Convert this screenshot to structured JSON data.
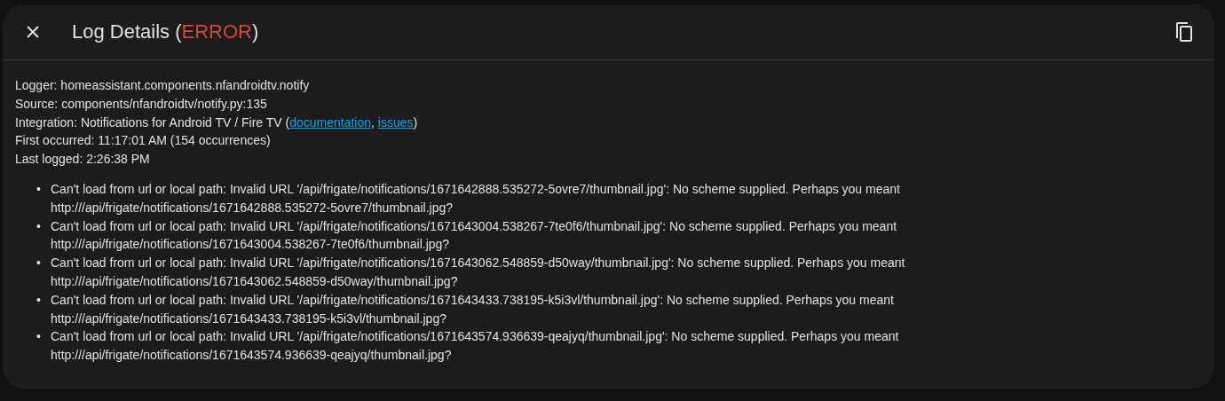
{
  "dialog": {
    "title": {
      "before": "Log Details (",
      "level": "ERROR",
      "after": ")"
    },
    "details": [
      {
        "kind": "text",
        "text": "Logger: homeassistant.components.nfandroidtv.notify"
      },
      {
        "kind": "text",
        "text": "Source: components/nfandroidtv/notify.py:135"
      },
      {
        "kind": "links",
        "before": "Integration: Notifications for Android TV / Fire TV (",
        "links": [
          "documentation",
          "issues"
        ],
        "separator": ", ",
        "after": ")"
      },
      {
        "kind": "text",
        "text": "First occurred: 11:17:01 AM (154 occurrences)"
      },
      {
        "kind": "text",
        "text": "Last logged: 2:26:38 PM"
      }
    ],
    "bullet": "•",
    "messages": [
      "Can't load from url or local path: Invalid URL '/api/frigate/notifications/1671642888.535272-5ovre7/thumbnail.jpg': No scheme supplied. Perhaps you meant http:///api/frigate/notifications/1671642888.535272-5ovre7/thumbnail.jpg?",
      "Can't load from url or local path: Invalid URL '/api/frigate/notifications/1671643004.538267-7te0f6/thumbnail.jpg': No scheme supplied. Perhaps you meant http:///api/frigate/notifications/1671643004.538267-7te0f6/thumbnail.jpg?",
      "Can't load from url or local path: Invalid URL '/api/frigate/notifications/1671643062.548859-d50way/thumbnail.jpg': No scheme supplied. Perhaps you meant http:///api/frigate/notifications/1671643062.548859-d50way/thumbnail.jpg?",
      "Can't load from url or local path: Invalid URL '/api/frigate/notifications/1671643433.738195-k5i3vl/thumbnail.jpg': No scheme supplied. Perhaps you meant http:///api/frigate/notifications/1671643433.738195-k5i3vl/thumbnail.jpg?",
      "Can't load from url or local path: Invalid URL '/api/frigate/notifications/1671643574.936639-qeajyq/thumbnail.jpg': No scheme supplied. Perhaps you meant http:///api/frigate/notifications/1671643574.936639-qeajyq/thumbnail.jpg?"
    ]
  }
}
